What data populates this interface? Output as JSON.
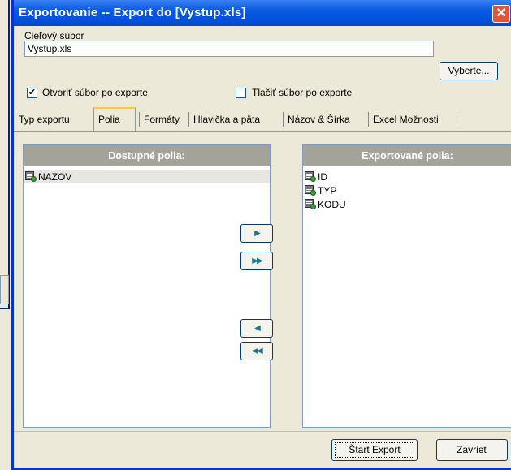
{
  "window": {
    "title": "Exportovanie -- Export do [Vystup.xls]",
    "close_glyph": "✕"
  },
  "target": {
    "label": "Cieľový súbor",
    "value": "Vystup.xls",
    "browse_label": "Vyberte..."
  },
  "options": {
    "open_after": {
      "label": "Otvoriť súbor po exporte",
      "checked": true,
      "mark": "✔"
    },
    "print_after": {
      "label": "Tlačiť súbor po exporte",
      "checked": false
    }
  },
  "tabs": [
    {
      "label": "Typ exportu"
    },
    {
      "label": "Polia",
      "active": true
    },
    {
      "label": "Formáty"
    },
    {
      "label": "Hlavička a päta"
    },
    {
      "label": "Názov & Šírka"
    },
    {
      "label": "Excel Možnosti"
    }
  ],
  "available": {
    "header": "Dostupné polia:",
    "items": [
      "NAZOV"
    ]
  },
  "exported": {
    "header": "Exportované polia:",
    "items": [
      "ID",
      "TYP",
      "KODU"
    ]
  },
  "move_buttons": {
    "add_one": "▶",
    "add_all": "▶▶",
    "remove_one": "◀",
    "remove_all": "◀◀"
  },
  "footer": {
    "start_label": "Štart Export",
    "close_label": "Zavrieť"
  },
  "colors": {
    "title_bar": "#0054e3",
    "dialog_bg": "#ece9d8",
    "panel_header": "#a3a39a",
    "arrow": "#1b7a8a"
  }
}
